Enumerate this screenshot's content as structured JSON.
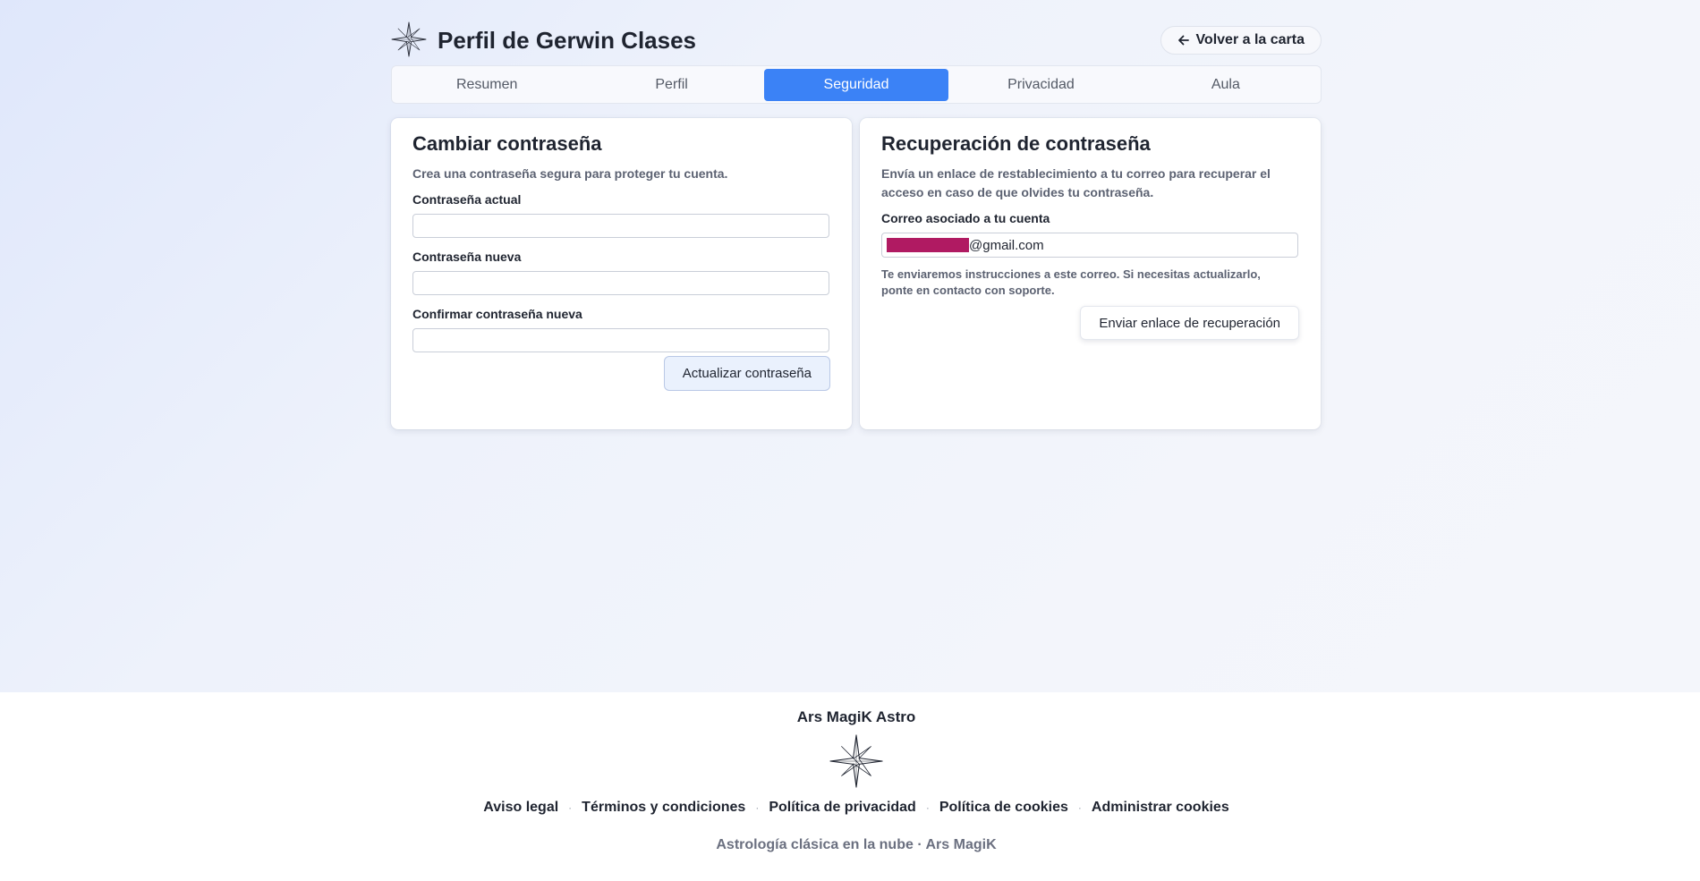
{
  "header": {
    "title": "Perfil de Gerwin Clases",
    "back_label": "Volver a la carta"
  },
  "tabs": [
    {
      "label": "Resumen",
      "active": false
    },
    {
      "label": "Perfil",
      "active": false
    },
    {
      "label": "Seguridad",
      "active": true
    },
    {
      "label": "Privacidad",
      "active": false
    },
    {
      "label": "Aula",
      "active": false
    }
  ],
  "change_password": {
    "title": "Cambiar contraseña",
    "description": "Crea una contraseña segura para proteger tu cuenta.",
    "current_label": "Contraseña actual",
    "current_value": "",
    "new_label": "Contraseña nueva",
    "new_value": "",
    "confirm_label": "Confirmar contraseña nueva",
    "confirm_value": "",
    "submit_label": "Actualizar contraseña"
  },
  "recovery": {
    "title": "Recuperación de contraseña",
    "description_line1": "Envía un enlace de restablecimiento a tu correo para recuperar el",
    "description_line2": "acceso en caso de que olvides tu contraseña.",
    "email_label": "Correo asociado a tu cuenta",
    "email_domain": "@gmail.com",
    "note_line1": "Te enviaremos instrucciones a este correo. Si necesitas actualizarlo,",
    "note_line2": "ponte en contacto con soporte.",
    "submit_label": "Enviar enlace de recuperación"
  },
  "footer": {
    "brand": "Ars MagiK Astro",
    "links": [
      "Aviso legal",
      "Términos y condiciones",
      "Política de privacidad",
      "Política de cookies",
      "Administrar cookies"
    ],
    "separator": "·",
    "tagline": "Astrología clásica en la nube · Ars MagiK"
  },
  "colors": {
    "accent": "#3b82f6",
    "redaction": "#b01a62"
  },
  "icons": {
    "logo": "compass-star-icon",
    "back": "arrow-left-icon"
  }
}
